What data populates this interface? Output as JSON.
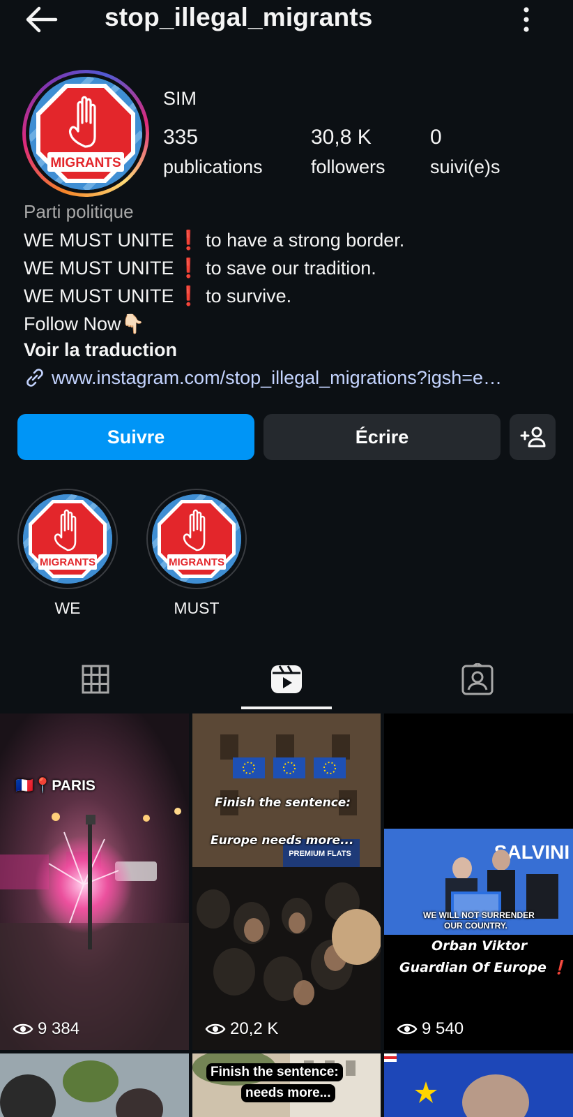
{
  "header": {
    "username": "stop_illegal_migrants",
    "back_icon": "arrow-left-icon",
    "more_icon": "vertical-dots-icon"
  },
  "profile": {
    "display_name": "SIM",
    "avatar_label": "MIGRANTS",
    "stats": [
      {
        "value": "335",
        "label": "publications"
      },
      {
        "value": "30,8 K",
        "label": "followers"
      },
      {
        "value": "0",
        "label": "suivi(e)s"
      }
    ],
    "category": "Parti politique",
    "bio_lines": [
      {
        "prefix": "WE MUST UNITE",
        "mark": "❗",
        "text": "to have a strong border."
      },
      {
        "prefix": "WE MUST UNITE",
        "mark": "❗",
        "text": "to save our tradition."
      },
      {
        "prefix": "WE MUST UNITE",
        "mark": "❗",
        "text": "to survive."
      }
    ],
    "follow_now": "Follow Now👇🏻",
    "translate": "Voir la traduction",
    "link": "www.instagram.com/stop_illegal_migrations?igsh=e…"
  },
  "actions": {
    "follow": "Suivre",
    "message": "Écrire",
    "add_person_icon": "add-person-icon"
  },
  "highlights": [
    {
      "label": "WE",
      "badge": "MIGRANTS"
    },
    {
      "label": "MUST",
      "badge": "MIGRANTS"
    }
  ],
  "tabs": [
    {
      "name": "grid",
      "icon": "grid-icon",
      "active": false
    },
    {
      "name": "reels",
      "icon": "reels-icon",
      "active": true
    },
    {
      "name": "tagged",
      "icon": "tagged-icon",
      "active": false
    }
  ],
  "reels": [
    {
      "views": "9 384",
      "caption": "🇫🇷📍PARIS"
    },
    {
      "views": "20,2 K",
      "caption_1": "Finish the sentence:",
      "caption_2": "Europe needs more...",
      "sign": "PREMIUM FLATS"
    },
    {
      "views": "9 540",
      "overlay_1": "WE WILL NOT SURRENDER",
      "overlay_2": "OUR COUNTRY.",
      "title_1": "Orban Viktor",
      "title_2": "Guardian Of Europe",
      "title_mark": "❗",
      "banner": "SALVINI"
    }
  ],
  "reels_row2": [
    {
      "caption_1": "Finish the sentence:",
      "caption_2": "needs more..."
    }
  ],
  "colors": {
    "background": "#0c1014",
    "accent": "#0095f6",
    "button_dark": "#25292e",
    "red": "#e0262c",
    "link": "#c4d4ff"
  }
}
